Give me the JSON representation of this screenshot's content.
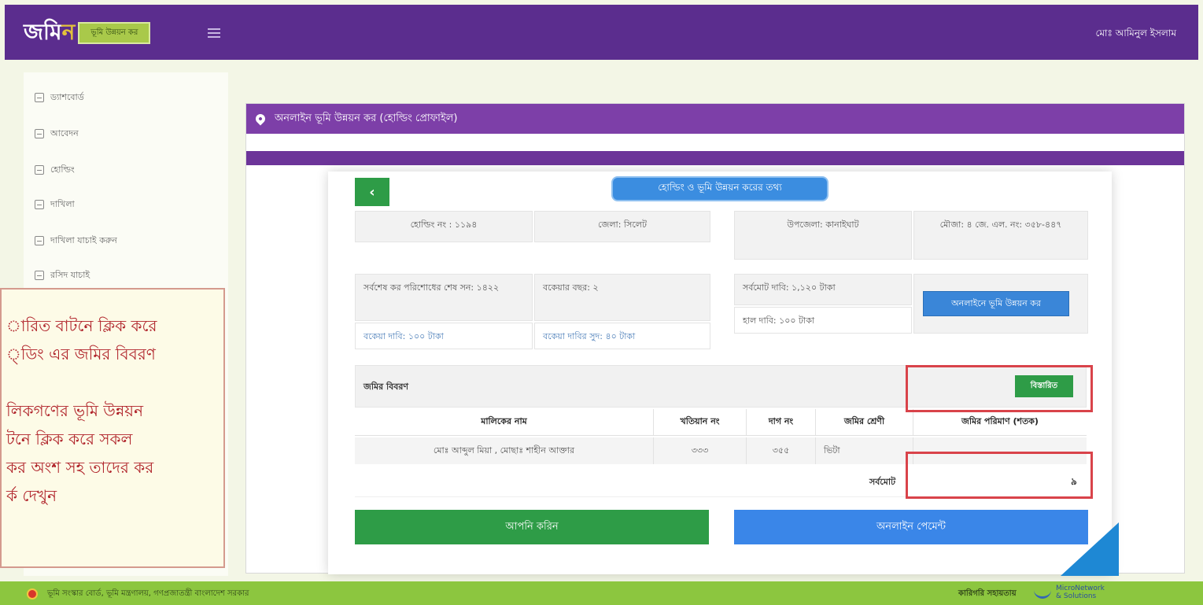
{
  "header": {
    "logo_main": "জমি",
    "logo_accent": "ন",
    "logo_tag": "ভূমি উন্নয়ন কর",
    "user_name": "মোঃ আমিনুল ইসলাম"
  },
  "sidebar": {
    "items": [
      {
        "label": "ড্যাশবোর্ড"
      },
      {
        "label": "আবেদন"
      },
      {
        "label": "হোল্ডিং"
      },
      {
        "label": "দাখিলা"
      },
      {
        "label": "দাখিলা যাচাই করুন"
      },
      {
        "label": "রসিদ যাচাই"
      }
    ]
  },
  "annotation": {
    "line1": "ারিত বাটনে ক্লিক করে",
    "line2": "্ডিং এর জমির বিবরণ",
    "line3": "লিকগণের ভূমি উন্নয়ন",
    "line4": "টনে ক্লিক করে সকল",
    "line5": "কর অংশ সহ তাদের কর",
    "line6": "র্ক দেখুন"
  },
  "panel": {
    "title": "অনলাইন ভূমি উন্নয়ন কর (হোল্ডিং প্রোফাইল)",
    "info_pill": "হোল্ডিং ও ভূমি উন্নয়ন করের তথ্য",
    "back_symbol": "‹"
  },
  "holding_info": {
    "holding_no": "হোল্ডিং নং : ১১৯৪",
    "district": "জেলা: সিলেট",
    "upazila": "উপজেলা: কানাইঘাট",
    "mouza": "মৌজা: ৪ জে. এল. নং: ৩৫৮-৪৪৭"
  },
  "tax_info": {
    "last_paid_year": "সর্বশেষ কর পরিশোধের শেষ সন: ১৪২২",
    "arrear_years": "বকেয়ার বছর: ২",
    "arrear_demand": "বকেয়া দাবি: ১০০ টাকা",
    "arrear_interest": "বকেয়া দাবির সুদ: ৪০ টাকা",
    "total_demand": "সর্বমোট দাবি: ১,১২০ টাকা",
    "current_demand": "হাল দাবি: ১০০ টাকা",
    "apply_button": "অনলাইনে ভূমি উন্নয়ন কর"
  },
  "land": {
    "title": "জমির বিবরণ",
    "details_button": "বিস্তারিত",
    "columns": [
      "মালিকের নাম",
      "খতিয়ান নং",
      "দাগ নং",
      "জমির শ্রেণী",
      "জমির পরিমাণ (শতক)"
    ],
    "rows": [
      [
        "মোঃ আব্দুল মিয়া , মোছাঃ শাহীন আক্তার",
        "৩৩৩",
        "৩৫৫",
        "ভিটা",
        ""
      ]
    ],
    "total_label": "সর্বমোট",
    "total_value": "৯"
  },
  "actions": {
    "pay_button": "আপনি করিন",
    "online_button": "অনলাইন পেমেন্ট"
  },
  "footer": {
    "left_text": "ভূমি সংস্কার বোর্ড, ভূমি মন্ত্রণালয়, গণপ্রজাতন্ত্রী বাংলাদেশ সরকার",
    "right_text": "কারিগরি সহায়তায়",
    "brand_line1": "MicroNetwork",
    "brand_line2": "& Solutions"
  },
  "colors": {
    "header": "#5b2d8e",
    "panel_head": "#7d3fa8",
    "green": "#2e9c47",
    "blue": "#3a86e8",
    "footer": "#8cc63f",
    "highlight": "#d9434a"
  }
}
